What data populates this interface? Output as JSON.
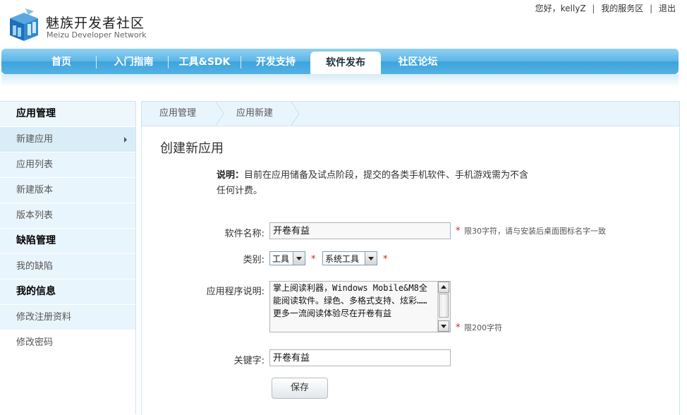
{
  "header": {
    "greeting": "您好，kellyZ",
    "my_service": "我的服务区",
    "logout": "退出",
    "logo_title": "魅族开发者社区",
    "logo_sub": "Meizu Developer Network"
  },
  "nav": {
    "items": [
      {
        "label": "首页"
      },
      {
        "label": "入门指南"
      },
      {
        "label": "工具&SDK"
      },
      {
        "label": "开发支持"
      },
      {
        "label": "软件发布"
      },
      {
        "label": "社区论坛"
      }
    ],
    "active": "软件发布"
  },
  "sidebar": {
    "sections": [
      {
        "title": "应用管理"
      },
      {
        "item": "新建应用"
      },
      {
        "item": "应用列表"
      },
      {
        "item": "新建版本"
      },
      {
        "item": "版本列表"
      },
      {
        "title": "缺陷管理"
      },
      {
        "item": "我的缺陷"
      },
      {
        "title": "我的信息"
      },
      {
        "item": "修改注册资料"
      },
      {
        "item": "修改密码"
      }
    ]
  },
  "breadcrumb": [
    "应用管理",
    "应用新建"
  ],
  "form": {
    "title": "创建新应用",
    "note_label": "说明：",
    "note_text": "目前在应用储备及试点阶段，提交的各类手机软件、手机游戏需为不含任何计费。",
    "name_label": "软件名称:",
    "name_value": "开卷有益",
    "name_hint": "限30字符，请与安装后桌面图标名字一致",
    "category_label": "类别:",
    "category_main": "工具",
    "category_sub": "系统工具",
    "desc_label": "应用程序说明:",
    "desc_value": "掌上阅读利器，Windows Mobile&M8全能阅读软件。绿色、多格式支持、炫彩……更多一流阅读体验尽在开卷有益",
    "desc_hint": "限200字符",
    "keyword_label": "关键字:",
    "keyword_value": "开卷有益",
    "save": "保存",
    "required_mark": "*"
  },
  "colors": {
    "nav_blue": "#3da3dc",
    "sidebar_bg": "#e9f5fc",
    "required_red": "#d32020"
  }
}
